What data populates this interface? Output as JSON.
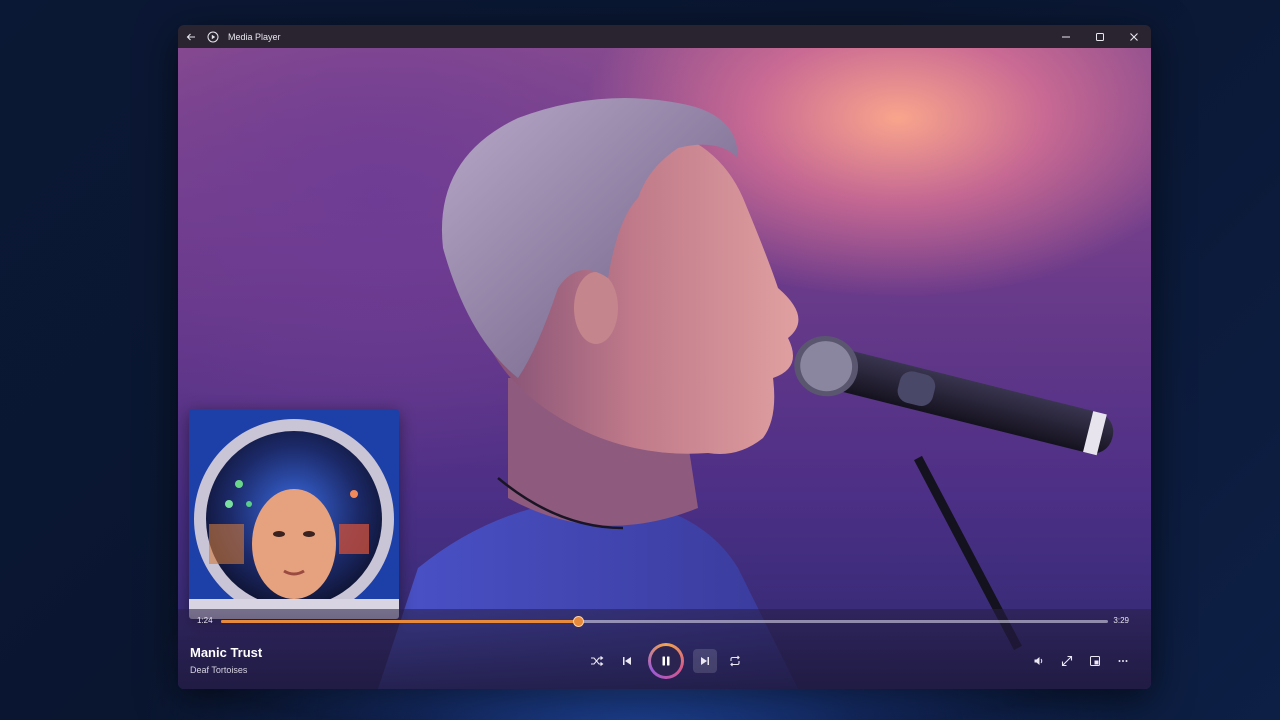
{
  "window": {
    "title": "Media Player"
  },
  "icons": {
    "back": "back-arrow-icon",
    "app": "media-player-logo-icon",
    "minimize": "minimize-icon",
    "maximize": "maximize-icon",
    "close": "close-icon",
    "shuffle": "shuffle-icon",
    "previous": "previous-icon",
    "pause": "pause-icon",
    "next": "next-icon",
    "repeat": "repeat-icon",
    "volume": "volume-icon",
    "fullscreen": "fullscreen-icon",
    "miniplayer": "miniplayer-icon",
    "more": "more-options-icon"
  },
  "now_playing": {
    "title": "Manic Trust",
    "artist": "Deaf Tortoises"
  },
  "playback": {
    "elapsed": "1:24",
    "total": "3:29",
    "progress": 0.403,
    "state": "playing"
  },
  "colors": {
    "accent": "#e78a3c",
    "titlebar": "#2a2430"
  }
}
